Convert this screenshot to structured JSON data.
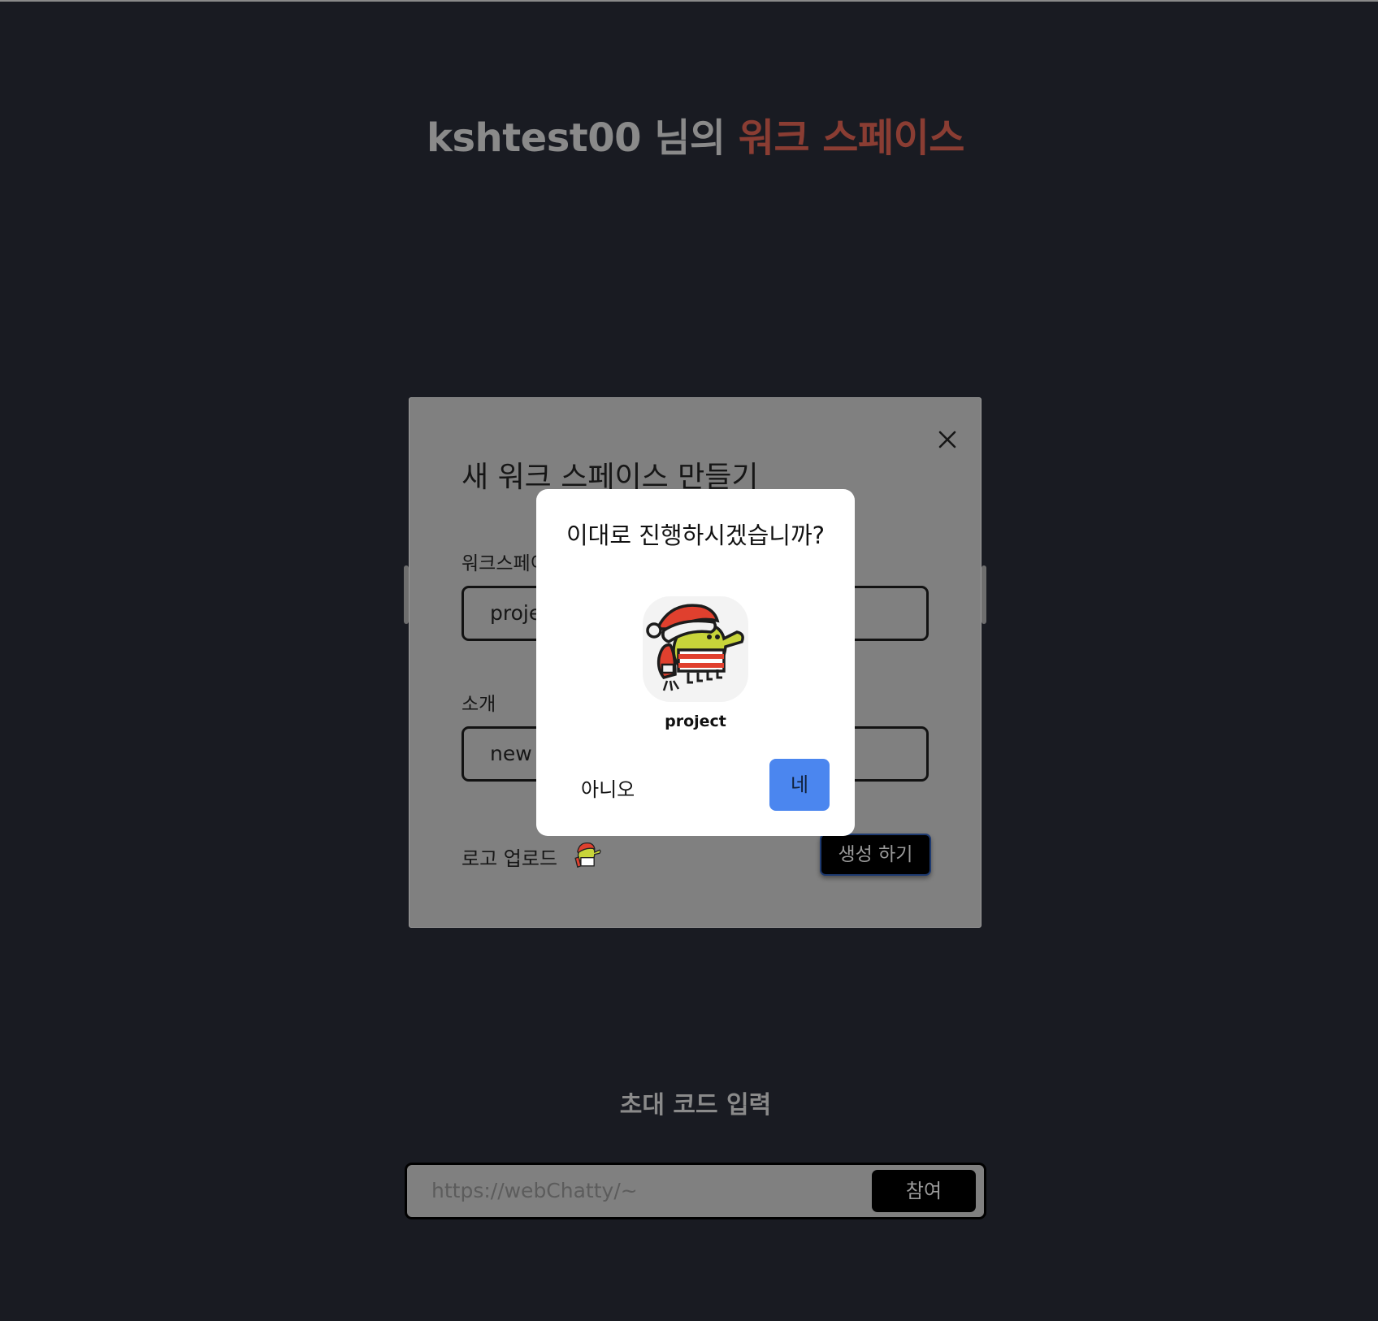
{
  "header": {
    "title_user": "kshtest00 님의",
    "title_accent": "워크 스페이스"
  },
  "create_modal": {
    "title": "새 워크 스페이스 만들기",
    "name_label": "워크스페이",
    "name_value": "proje",
    "intro_label": "소개",
    "intro_value": "new",
    "logo_label": "로고 업로드",
    "create_button": "생성 하기"
  },
  "confirm_dialog": {
    "question": "이대로 진행하시겠습니까?",
    "workspace_name": "project",
    "no_button": "아니오",
    "yes_button": "네"
  },
  "invite": {
    "title": "초대 코드 입력",
    "placeholder": "https://webChatty/~",
    "join_button": "참여"
  },
  "colors": {
    "background": "#191b22",
    "accent": "#8a3d33",
    "confirm_primary": "#4b86ef"
  },
  "icons": {
    "close": "close-icon",
    "logo": "doodle-jump-logo"
  }
}
